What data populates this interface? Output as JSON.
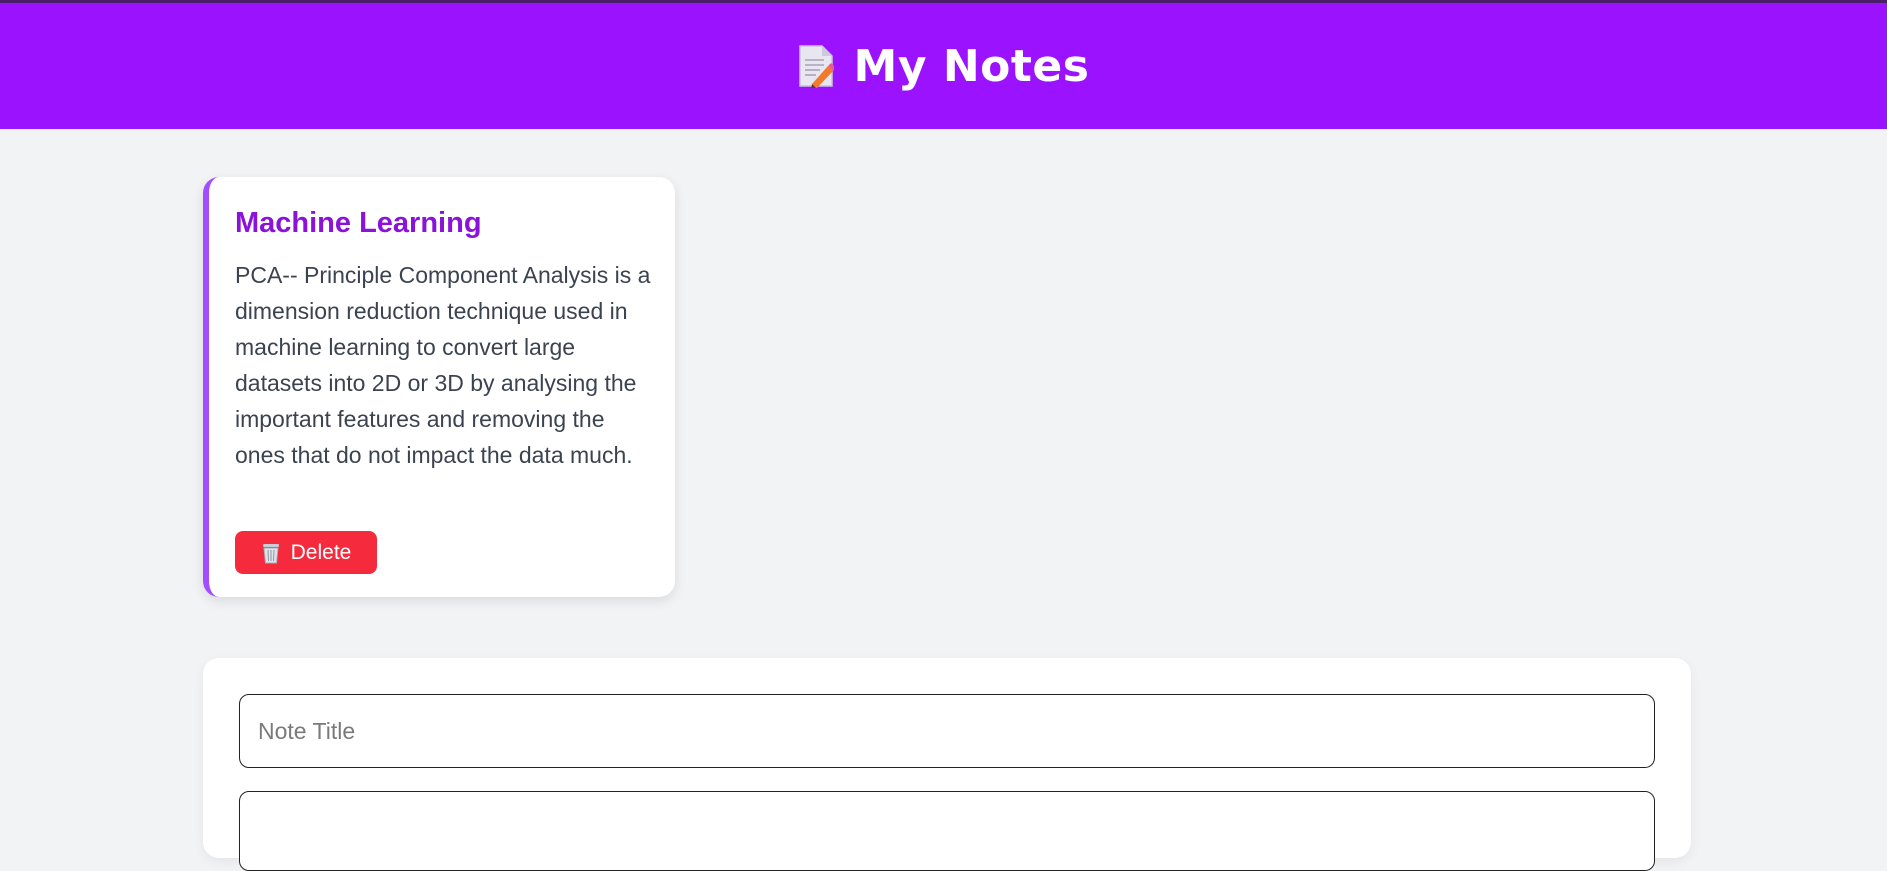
{
  "header": {
    "title": "My Notes",
    "icon": "memo-icon"
  },
  "notes": [
    {
      "title": "Machine Learning",
      "body": "PCA-- Principle Component Analysis is a dimension reduction technique used in machine learning to convert large datasets into 2D or 3D by analysing the important features and removing the ones that do not impact the data much.",
      "delete_label": "Delete",
      "delete_icon": "wastebasket-icon"
    }
  ],
  "form": {
    "title_placeholder": "Note Title",
    "title_value": ""
  },
  "colors": {
    "header_bg": "#9b12ff",
    "note_title": "#8a12d9",
    "note_accent": "#a24dff",
    "delete_bg": "#f62a3d",
    "page_bg": "#f2f3f5"
  }
}
